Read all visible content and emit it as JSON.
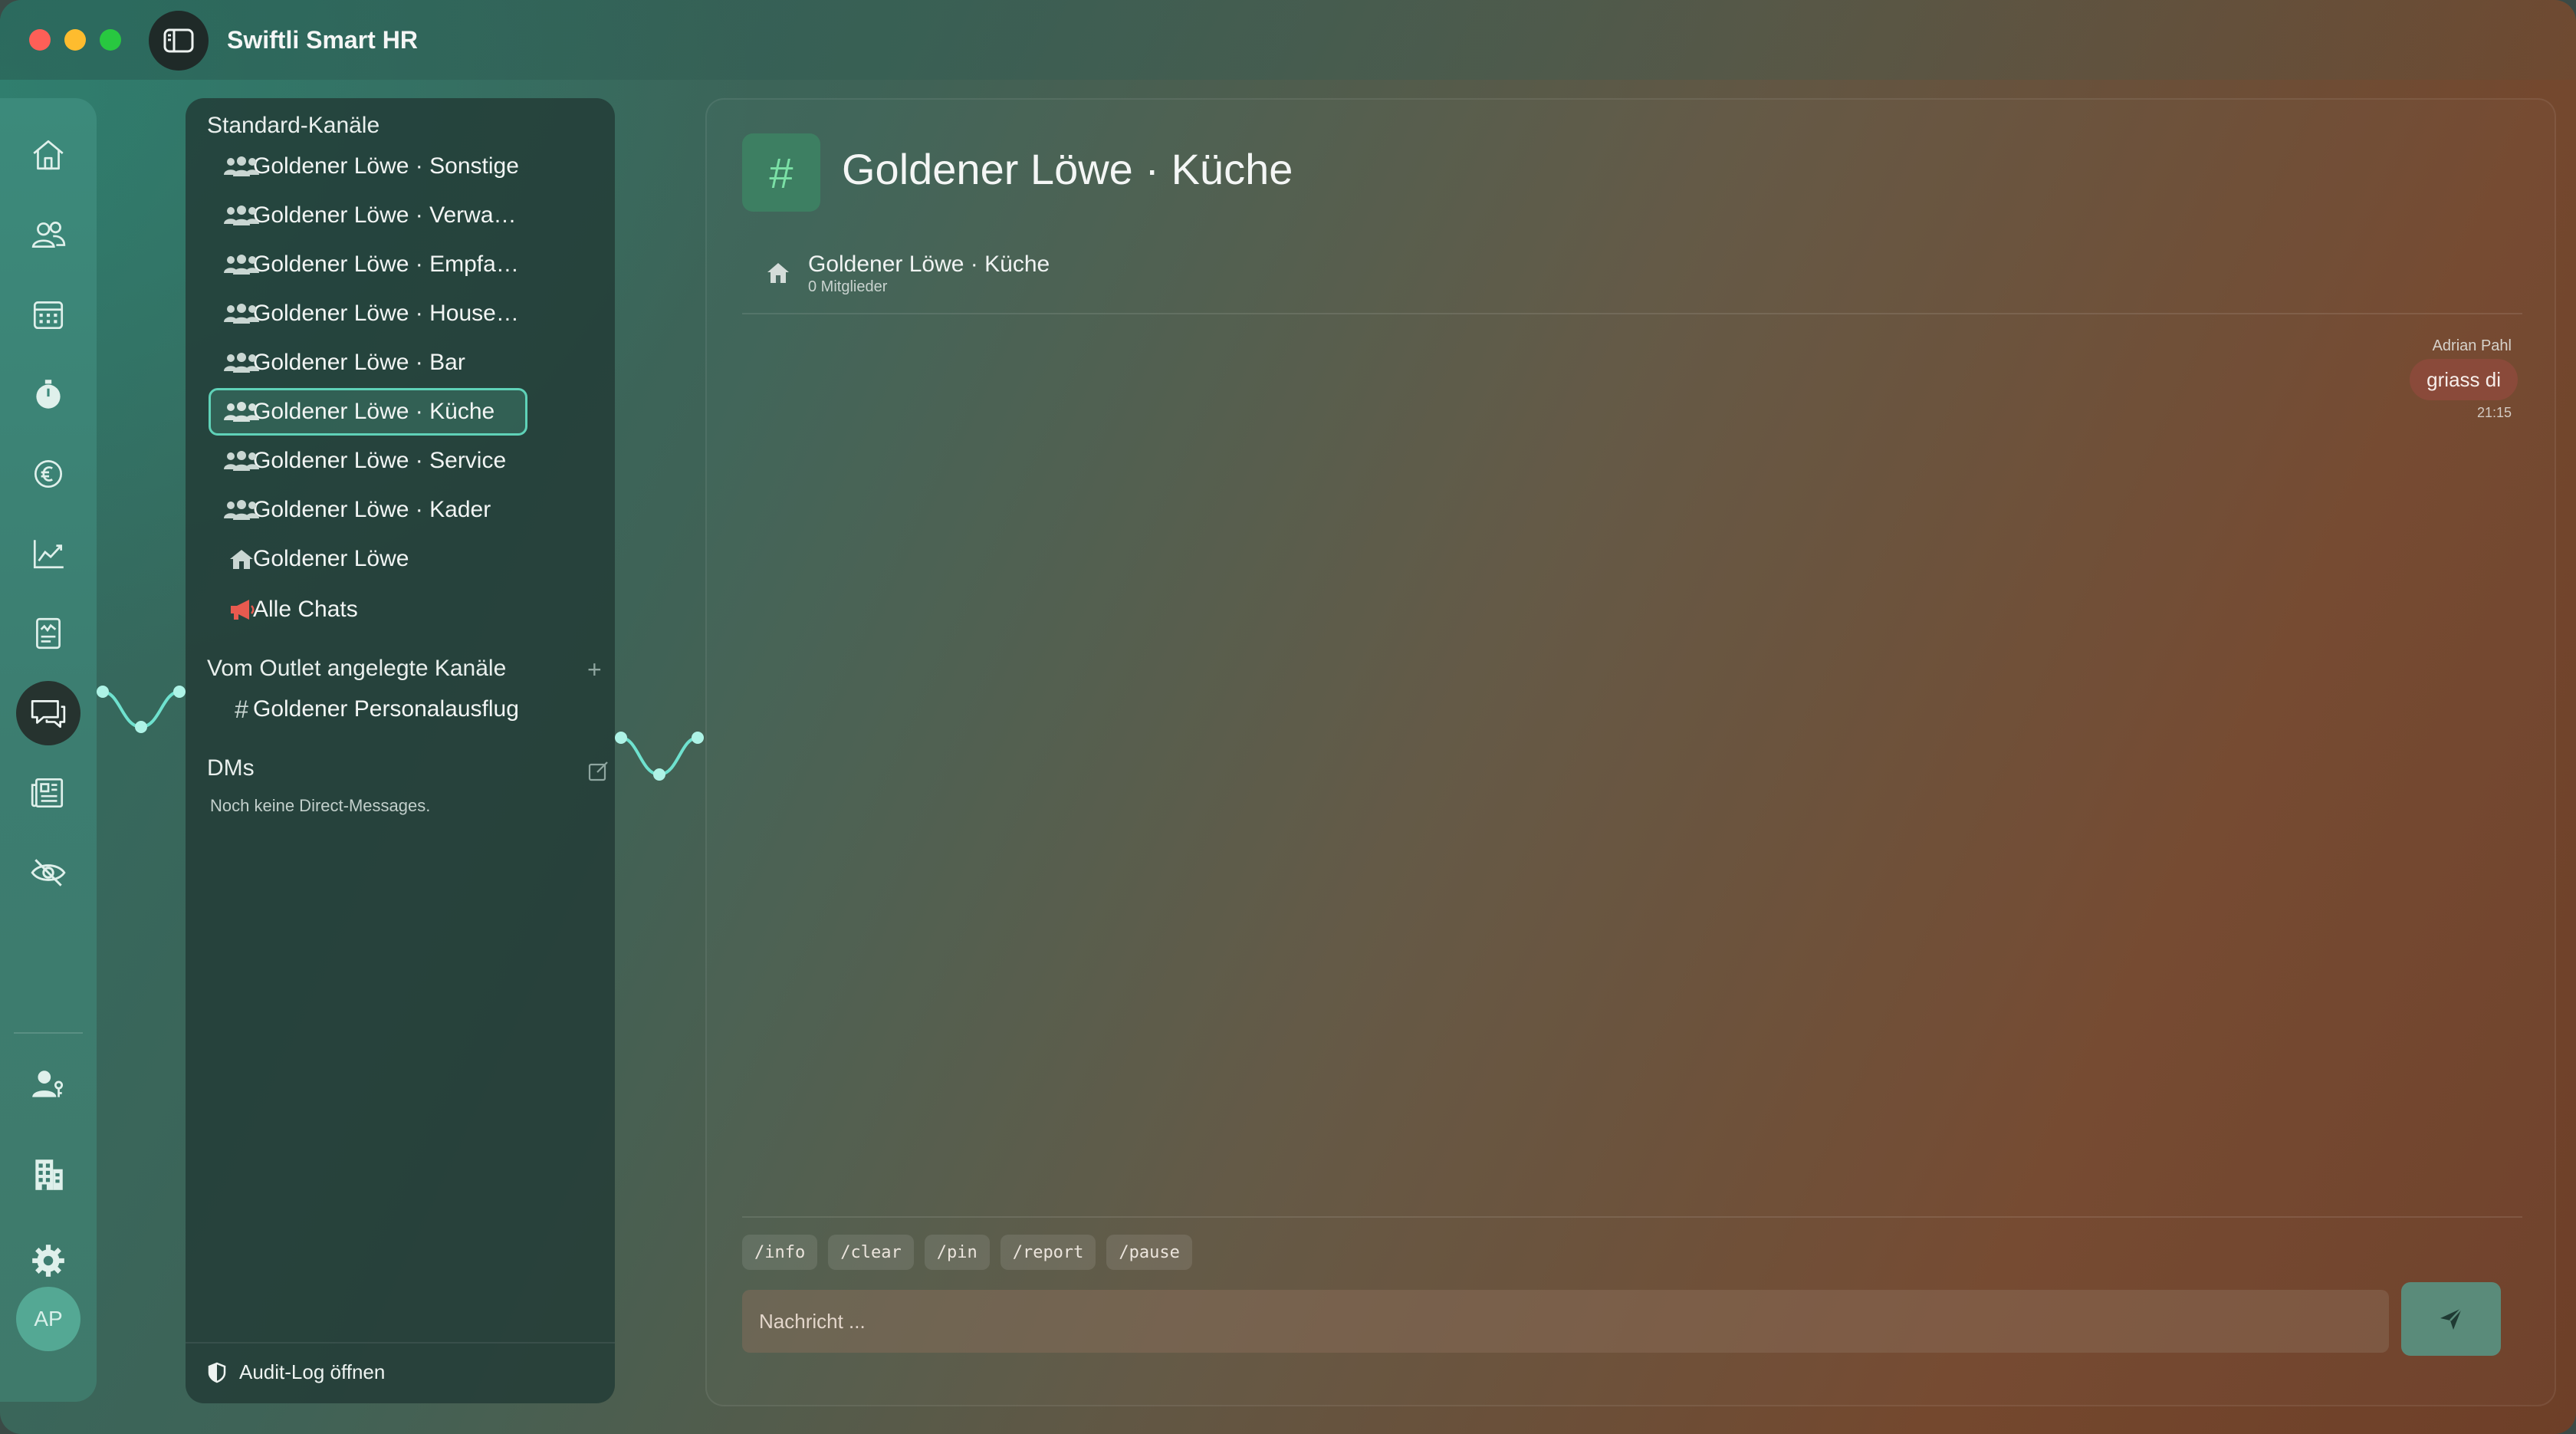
{
  "app": {
    "title": "Swiftli Smart HR"
  },
  "rail": {
    "items": [
      "home-icon",
      "people-icon",
      "calendar-icon",
      "stopwatch-icon",
      "euro-icon",
      "chart-icon",
      "document-icon",
      "chat-icon",
      "newspaper-icon",
      "eye-off-icon",
      "user-key-icon",
      "building-icon",
      "gear-icon"
    ],
    "active": "chat-icon",
    "avatar_initials": "AP"
  },
  "sidebar": {
    "standard_title": "Standard-Kanäle",
    "standard_channels": [
      {
        "label": "Goldener Löwe · Sonstige",
        "icon": "group-icon"
      },
      {
        "label": "Goldener Löwe · Verwaltu…",
        "icon": "group-icon"
      },
      {
        "label": "Goldener Löwe · Empfang",
        "icon": "group-icon"
      },
      {
        "label": "Goldener Löwe · Housek…",
        "icon": "group-icon"
      },
      {
        "label": "Goldener Löwe · Bar",
        "icon": "group-icon"
      },
      {
        "label": "Goldener Löwe · Küche",
        "icon": "group-icon",
        "active": true
      },
      {
        "label": "Goldener Löwe · Service",
        "icon": "group-icon"
      },
      {
        "label": "Goldener Löwe · Kader",
        "icon": "group-icon"
      },
      {
        "label": "Goldener Löwe",
        "icon": "house-icon"
      },
      {
        "label": "Alle Chats",
        "icon": "megaphone-icon"
      }
    ],
    "outlet_title": "Vom Outlet angelegte Kanäle",
    "outlet_add": "+",
    "outlet_channels": [
      {
        "label": "Goldener Personalausflug",
        "icon": "hash-icon"
      }
    ],
    "dms_title": "DMs",
    "dms_empty": "Noch keine Direct-Messages.",
    "audit_label": "Audit-Log öffnen"
  },
  "channel": {
    "hash": "#",
    "title": "Goldener Löwe · Küche",
    "info_name": "Goldener Löwe · Küche",
    "info_members": "0 Mitglieder"
  },
  "messages": [
    {
      "author": "Adrian Pahl",
      "text": "griass di",
      "time": "21:15"
    }
  ],
  "composer": {
    "commands": [
      "/info",
      "/clear",
      "/pin",
      "/report",
      "/pause"
    ],
    "placeholder": "Nachricht ...",
    "send_icon": "send-icon"
  },
  "colors": {
    "accent": "#5fd2b8",
    "hash_bg": "#3d7f62",
    "bubble": "#8a4a3a",
    "send": "#5a8b7a"
  }
}
